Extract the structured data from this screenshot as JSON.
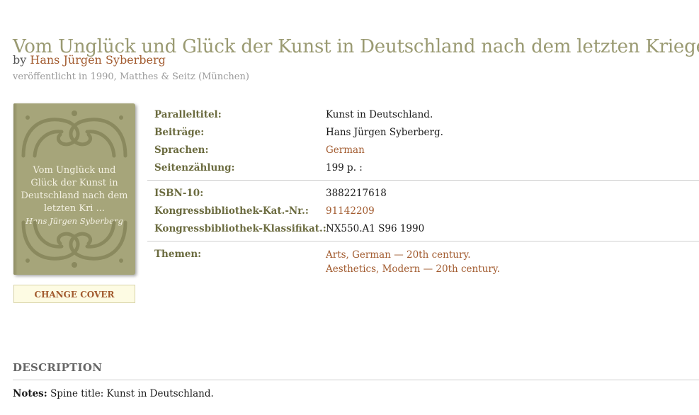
{
  "book": {
    "title": "Vom Unglück und Glück der Kunst in Deutschland nach dem letzten Kriege",
    "by_prefix": "by",
    "author": "Hans Jürgen Syberberg",
    "published": "veröffentlicht in 1990, Matthes & Seitz (München)"
  },
  "cover": {
    "title_text": "Vom Unglück und Glück der Kunst in Deutschland nach dem letzten Kri ...",
    "author_text": "Hans Jürgen Syberberg",
    "change_cover_label": "CHANGE COVER",
    "colors": {
      "background": "#a6a57a",
      "ornament": "#8a895e",
      "text": "#f4f1e2"
    }
  },
  "details": {
    "group1": [
      {
        "label": "Paralleltitel:",
        "value": "Kunst in Deutschland."
      },
      {
        "label": "Beiträge:",
        "value": "Hans Jürgen Syberberg."
      },
      {
        "label": "Sprachen:",
        "value": "German"
      },
      {
        "label": "Seitenzählung:",
        "value": "199 p. :"
      }
    ],
    "group2": [
      {
        "label": "ISBN-10:",
        "value": "3882217618"
      },
      {
        "label": "Kongressbibliothek-Kat.-Nr.:",
        "value": "91142209"
      },
      {
        "label": "Kongressbibliothek-Klassifikat.:",
        "value": "NX550.A1 S96 1990"
      }
    ],
    "themen": {
      "label": "Themen:",
      "values": [
        "Arts, German — 20th century.",
        "Aesthetics, Modern — 20th century."
      ]
    }
  },
  "description": {
    "heading": "DESCRIPTION",
    "notes_label": "Notes:",
    "notes_text": "Spine title: Kunst in Deutschland."
  },
  "colors": {
    "title": "#9a9a72",
    "link": "#a25b2f",
    "label": "#6b6b3f"
  }
}
